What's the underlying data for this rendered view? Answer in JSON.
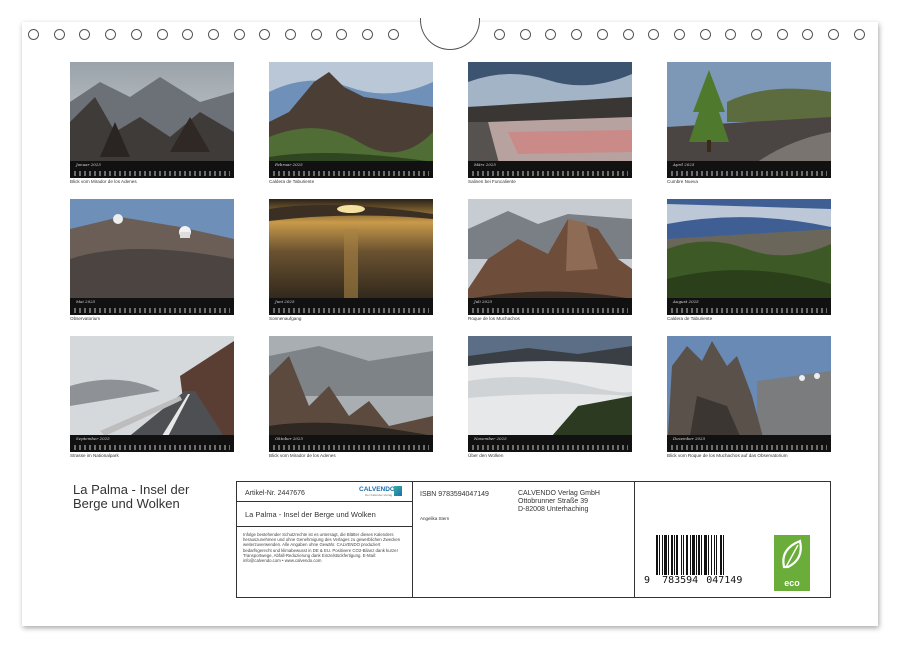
{
  "calendar": {
    "title": "La Palma - Insel der Berge und Wolken",
    "months": [
      {
        "name": "Januar 2025",
        "caption": "Blick vom Mirador de los Adenes"
      },
      {
        "name": "Februar 2025",
        "caption": "Caldera de Taburiente"
      },
      {
        "name": "März 2025",
        "caption": "Salinen bei Funcaliente"
      },
      {
        "name": "April 2025",
        "caption": "Cumbre Nueva"
      },
      {
        "name": "Mai 2025",
        "caption": "Observatorium"
      },
      {
        "name": "Juni 2025",
        "caption": "Sonnenaufgang"
      },
      {
        "name": "Juli 2025",
        "caption": "Roque de los Muchachos"
      },
      {
        "name": "August 2025",
        "caption": "Caldera de Taburiente"
      },
      {
        "name": "September 2025",
        "caption": "Strasse im Nationalpark"
      },
      {
        "name": "Oktober 2025",
        "caption": "Blick vom Mirador de los Adenes"
      },
      {
        "name": "November 2025",
        "caption": "Über den Wolken"
      },
      {
        "name": "Dezember 2025",
        "caption": "Blick vom Roque de los Muchachos auf das Observatorium"
      }
    ]
  },
  "info": {
    "article_label": "Artikel-Nr. 2447676",
    "brand": "CALVENDO",
    "brand_sub": "Der Kalender-Verlag",
    "product_title": "La Palma - Insel der Berge und Wolken",
    "legal_text": "Infolge bestehender Schutzrechte ist es untersagt, die Blätter dieses Kalenders herauszunehmen und ohne Genehmigung des Verlages zu gewerblichen Zwecken weiterzuverwenden. Alle Angaben ohne Gewähr. CALVENDO produziert bedarfsgerecht und klimabewusst in DE & EU. Positivere CO2-Bilanz dank kurzer Transportwege, Abfall-Reduzierung dank Einzelstückfertigung. E-Mail: info@calvendo.com • www.calvendo.com",
    "isbn": "ISBN 9783594047149",
    "publisher_lines": [
      "CALVENDO Verlag GmbH",
      "Ottobrunner Straße 39",
      "D-82008 Unterhaching"
    ],
    "author": "Angelika Stern",
    "barcode_digits": {
      "first": "9",
      "group1": "783594",
      "group2": "047149"
    },
    "eco_label": "eco"
  },
  "colors": {
    "eco_green": "#6aad3a",
    "text": "#333333"
  }
}
